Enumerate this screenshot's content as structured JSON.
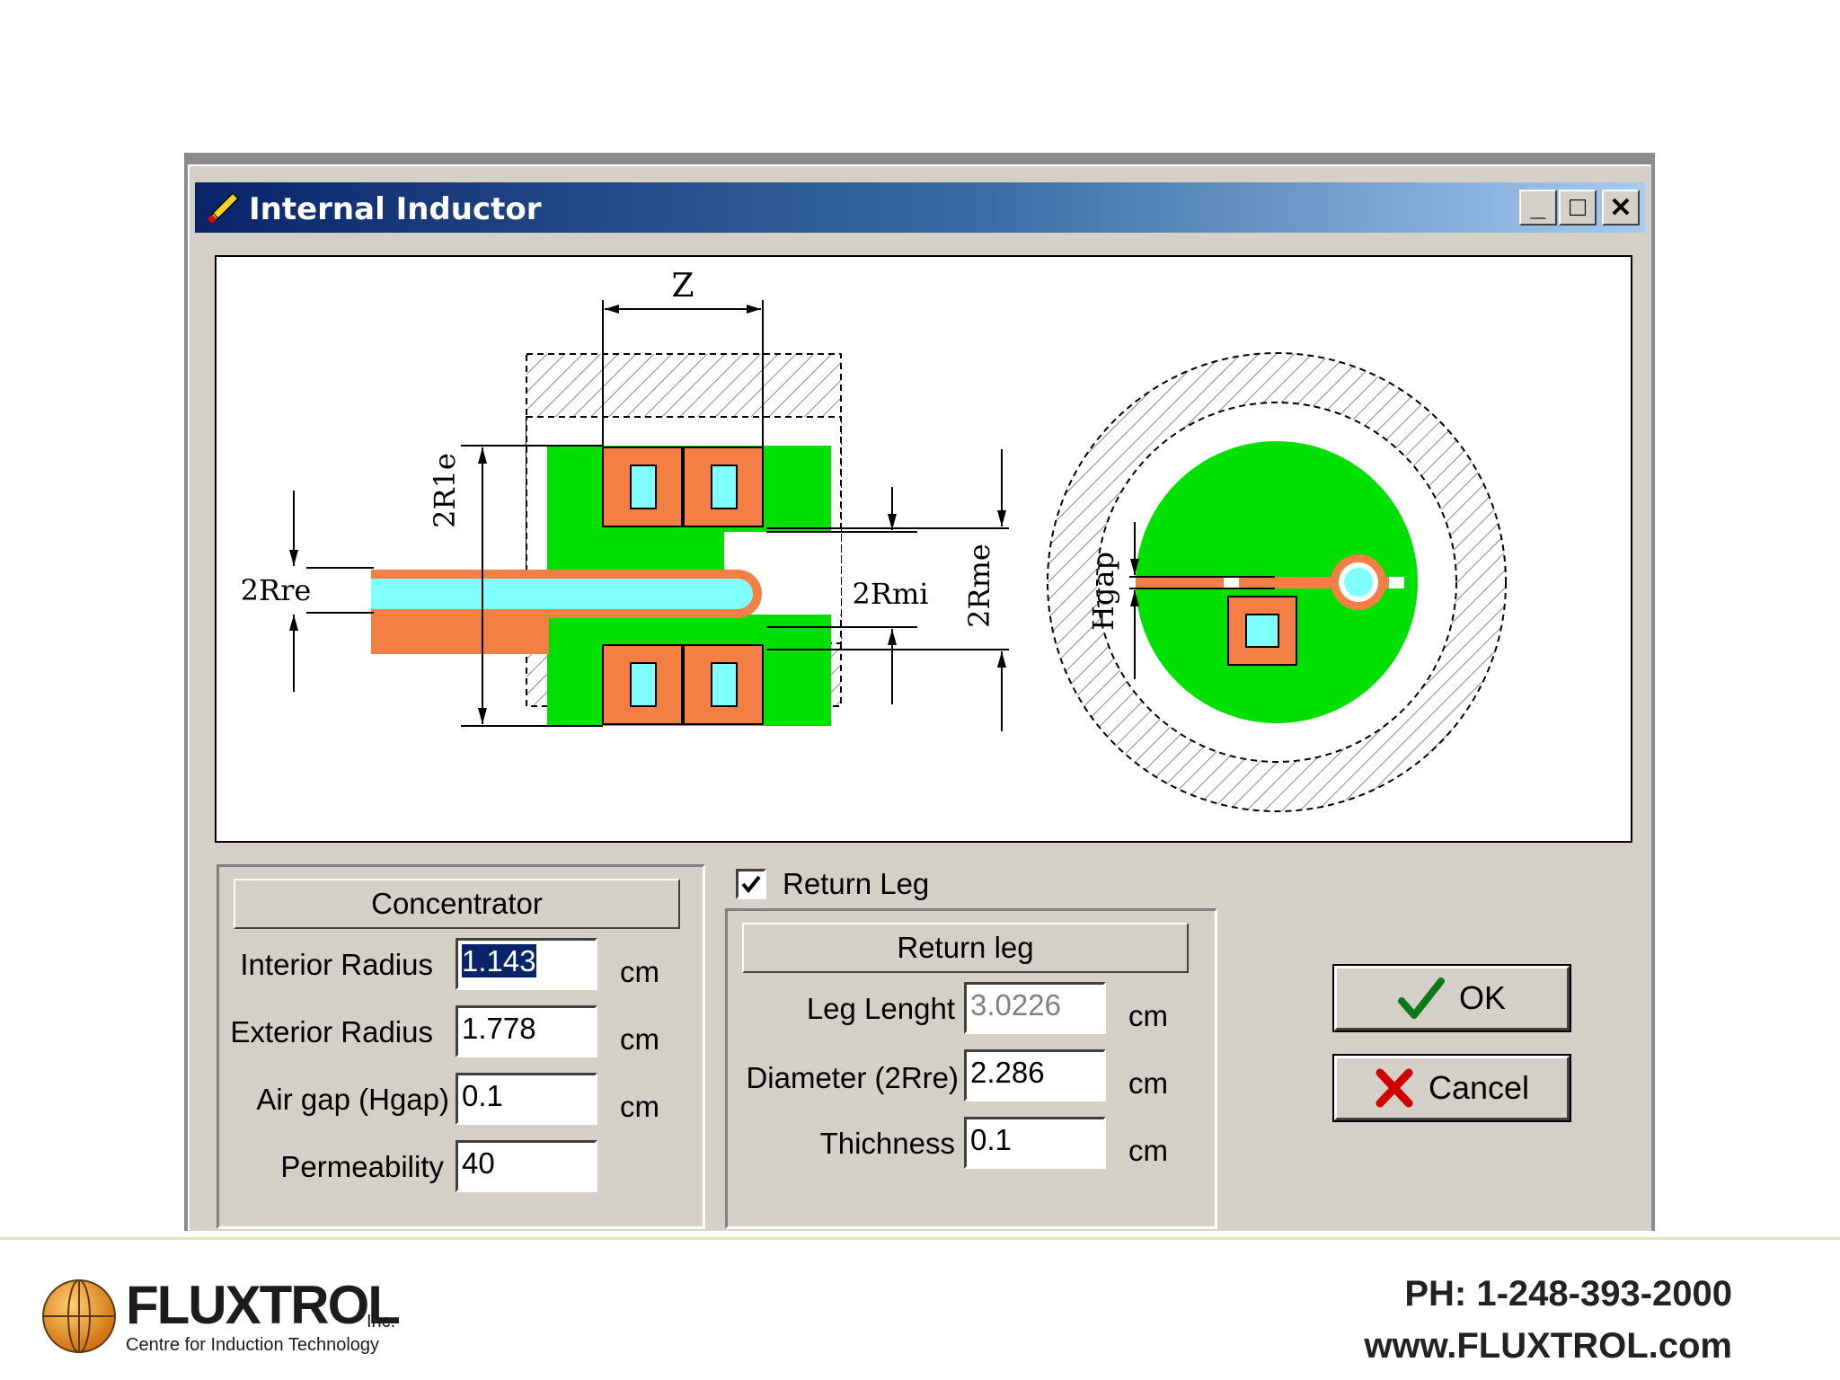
{
  "window": {
    "title": "Internal Inductor",
    "minimize_glyph": "_",
    "maximize_glyph": "□",
    "close_glyph": "✕"
  },
  "diagram": {
    "label_z": "Z",
    "label_2r1e": "2R1e",
    "label_2rre": "2Rre",
    "label_2rmi": "2Rmi",
    "label_2rme": "2Rme",
    "label_hgap": "Hgap"
  },
  "concentrator": {
    "header": "Concentrator",
    "fields": [
      {
        "label": "Interior Radius",
        "value": "1.143",
        "unit": "cm"
      },
      {
        "label": "Exterior Radius",
        "value": "1.778",
        "unit": "cm"
      },
      {
        "label": "Air gap (Hgap)",
        "value": "0.1",
        "unit": "cm"
      },
      {
        "label": "Permeability",
        "value": "40"
      }
    ]
  },
  "return_leg": {
    "checkbox_label": "Return Leg",
    "checked": true,
    "header": "Return leg",
    "fields": [
      {
        "label": "Leg Lenght",
        "value": "3.0226",
        "unit": "cm"
      },
      {
        "label": "Diameter (2Rre)",
        "value": "2.286",
        "unit": "cm"
      },
      {
        "label": "Thichness",
        "value": "0.1",
        "unit": "cm"
      }
    ]
  },
  "buttons": {
    "ok": "OK",
    "cancel": "Cancel"
  },
  "footer": {
    "brand": "FLUXTROL",
    "brand_suffix": "Inc.",
    "tagline": "Centre for Induction Technology",
    "phone": "PH: 1-248-393-2000",
    "website": "www.FLUXTROL.com"
  },
  "colors": {
    "concentrator_green": "#00e000",
    "coil_orange": "#f47f45",
    "water_cyan": "#7fffff"
  }
}
